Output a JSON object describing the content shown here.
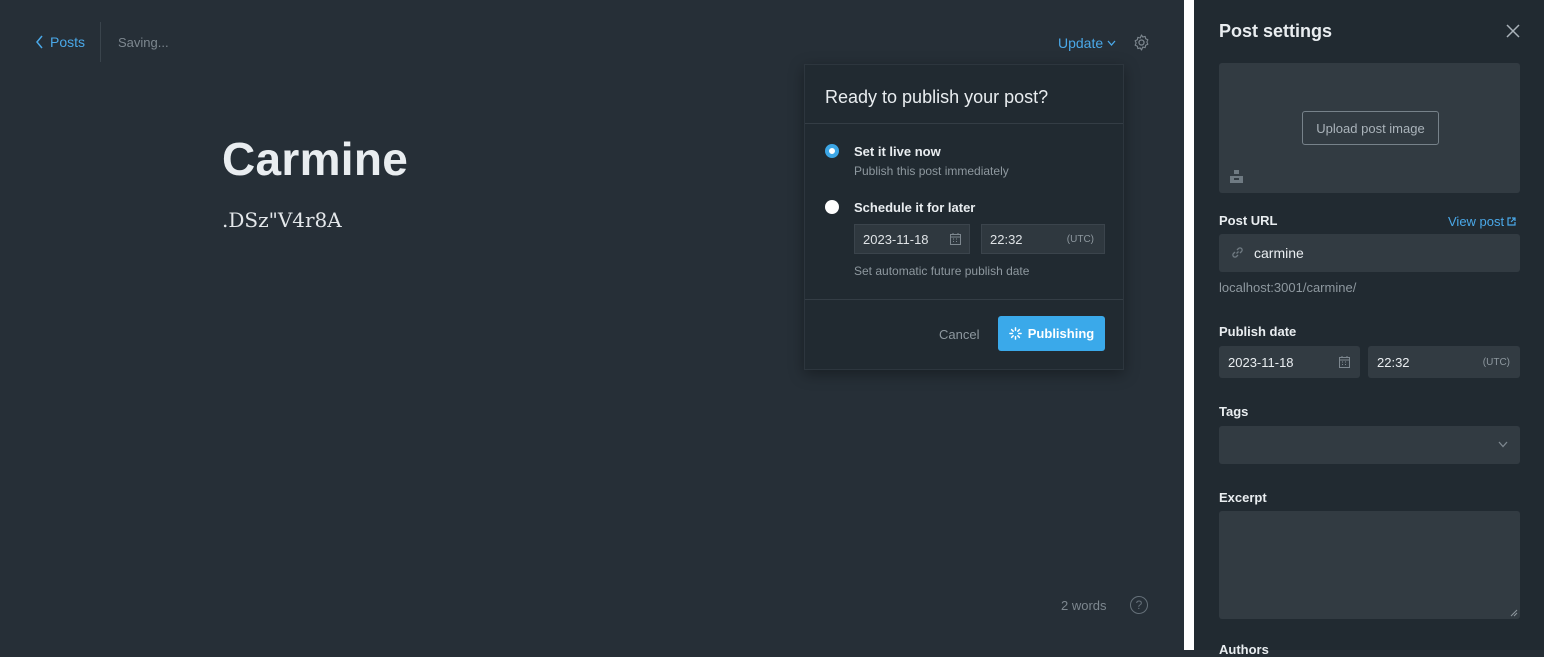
{
  "editor": {
    "back_label": "Posts",
    "status": "Saving...",
    "update_label": "Update",
    "title": "Carmine",
    "body": ".DSz\"V4r8A",
    "word_count": "2 words",
    "help_glyph": "?"
  },
  "publish_popup": {
    "title": "Ready to publish your post?",
    "option_now_label": "Set it live now",
    "option_now_sub": "Publish this post immediately",
    "option_later_label": "Schedule it for later",
    "date": "2023-11-18",
    "time": "22:32",
    "tz": "(UTC)",
    "option_later_sub": "Set automatic future publish date",
    "cancel_label": "Cancel",
    "publish_label": "Publishing",
    "selected_option": "now"
  },
  "settings": {
    "title": "Post settings",
    "upload_label": "Upload post image",
    "post_url_label": "Post URL",
    "view_post_label": "View post",
    "slug": "carmine",
    "url_preview": "localhost:3001/carmine/",
    "publish_date_label": "Publish date",
    "date": "2023-11-18",
    "time": "22:32",
    "tz": "(UTC)",
    "tags_label": "Tags",
    "excerpt_label": "Excerpt",
    "next_label": "Authors"
  },
  "colors": {
    "accent": "#3aa9ea",
    "background": "#262f37",
    "panel": "#212a31"
  }
}
